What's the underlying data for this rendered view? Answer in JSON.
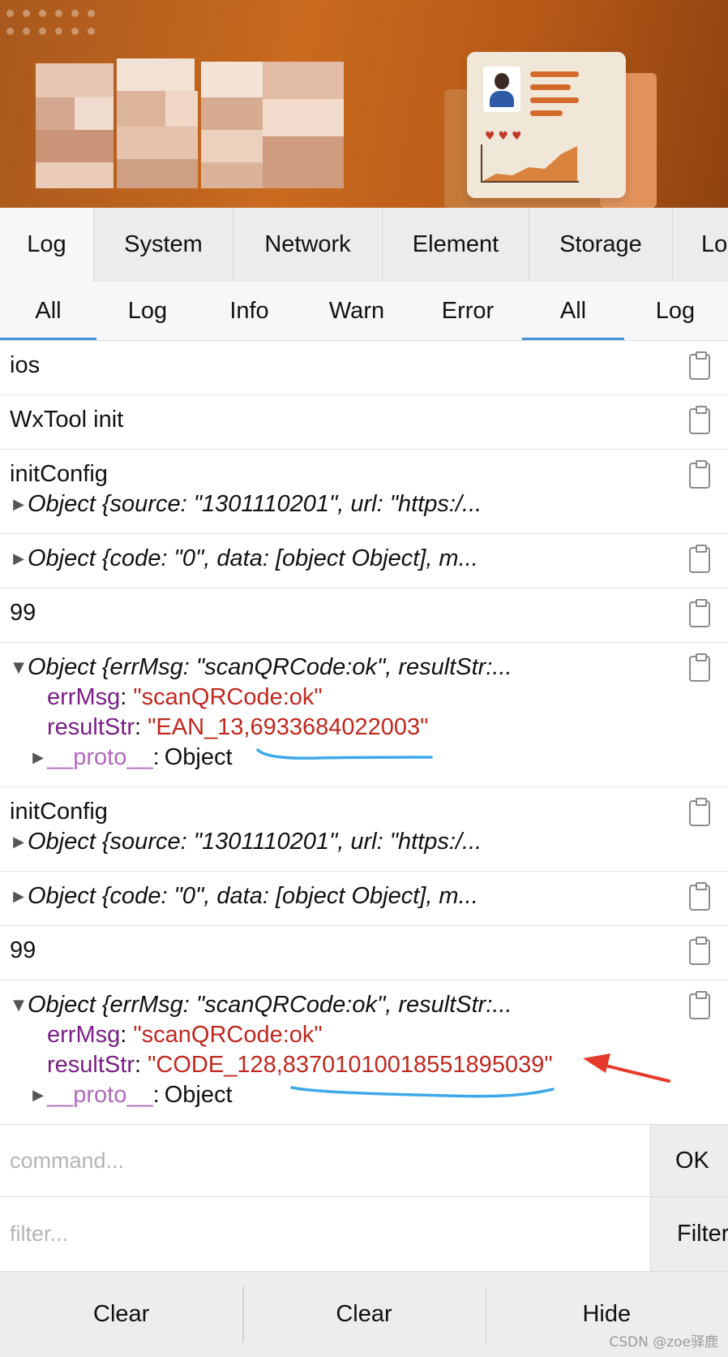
{
  "tabs": [
    {
      "label": "Log",
      "active": true
    },
    {
      "label": "System",
      "active": false
    },
    {
      "label": "Network",
      "active": false
    },
    {
      "label": "Element",
      "active": false
    },
    {
      "label": "Storage",
      "active": false
    },
    {
      "label": "Lo",
      "active": false
    }
  ],
  "subtabs": [
    {
      "label": "All",
      "active": true
    },
    {
      "label": "Log",
      "active": false
    },
    {
      "label": "Info",
      "active": false
    },
    {
      "label": "Warn",
      "active": false
    },
    {
      "label": "Error",
      "active": false
    },
    {
      "label": "All",
      "active": true
    },
    {
      "label": "Log",
      "active": false
    }
  ],
  "logs": {
    "r1": "ios",
    "r2": "WxTool init",
    "r3_title": "initConfig",
    "r3_obj": "Object {source: \"1301110201\", url: \"https:/...",
    "r4_obj": "Object {code: \"0\", data: [object Object], m...",
    "r5": "99",
    "r6_obj": "Object {errMsg: \"scanQRCode:ok\", resultStr:...",
    "r6_errmsg_key": "errMsg",
    "r6_errmsg_val": "\"scanQRCode:ok\"",
    "r6_result_key": "resultStr",
    "r6_result_val": "\"EAN_13,6933684022003\"",
    "r6_proto_key": "__proto__",
    "r6_proto_val": "Object",
    "r7_title": "initConfig",
    "r7_obj": "Object {source: \"1301110201\", url: \"https:/...",
    "r8_obj": "Object {code: \"0\", data: [object Object], m...",
    "r9": "99",
    "r10_obj": "Object {errMsg: \"scanQRCode:ok\", resultStr:...",
    "r10_errmsg_key": "errMsg",
    "r10_errmsg_val": "\"scanQRCode:ok\"",
    "r10_result_key": "resultStr",
    "r10_result_val": "\"CODE_128,83701010018551895039\"",
    "r10_proto_key": "__proto__",
    "r10_proto_val": "Object"
  },
  "command": {
    "placeholder": "command...",
    "button": "OK"
  },
  "filter": {
    "placeholder": "filter...",
    "button": "Filter"
  },
  "toolbar": {
    "clear1": "Clear",
    "clear2": "Clear",
    "hide": "Hide"
  },
  "watermark": "CSDN @zoe驿鹿",
  "colors": {
    "banner": "#c96a1f",
    "key": "#7a1f86",
    "value": "#c0281f",
    "underline": "#3fa8e8",
    "arrow": "#e53b2a",
    "active_indicator": "#4a90d9"
  }
}
